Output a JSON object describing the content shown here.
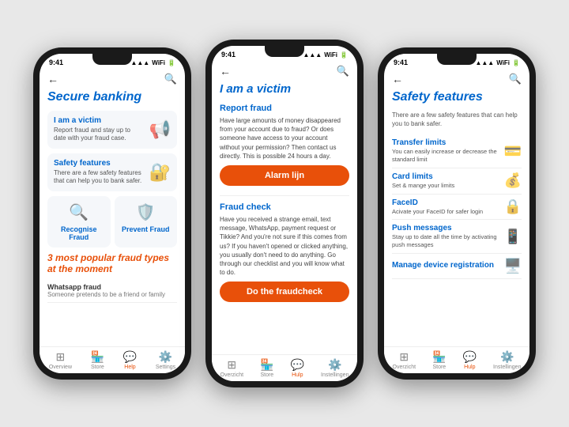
{
  "phone1": {
    "statusBar": {
      "time": "9:41",
      "signal": "▲▲▲",
      "wifi": "WiFi",
      "battery": "🔋"
    },
    "pageTitle": "Secure banking",
    "card1": {
      "title": "I am a victim",
      "desc": "Report fraud and stay up to date with your fraud case.",
      "icon": "📢"
    },
    "card2": {
      "title": "Safety features",
      "desc": "There are a few safety features that can help you to bank safer.",
      "icon": "🔐"
    },
    "smallCard1": {
      "label": "Recognise Fraud",
      "icon": "🔍"
    },
    "smallCard2": {
      "label": "Prevent Fraud",
      "icon": "🛡️"
    },
    "sectionTitle": "3 most popular fraud types at the moment",
    "listItem1": {
      "title": "Whatsapp fraud",
      "sub": "Someone pretends to be a friend or family"
    },
    "bottomNav": [
      {
        "label": "Overview",
        "icon": "⊞",
        "active": false
      },
      {
        "label": "Store",
        "icon": "🏪",
        "active": false
      },
      {
        "label": "Help",
        "icon": "💬",
        "active": true
      },
      {
        "label": "Settings",
        "icon": "⚙️",
        "active": false
      }
    ]
  },
  "phone2": {
    "statusBar": {
      "time": "9:41"
    },
    "pageTitle": "I am a victim",
    "section1Title": "Report fraud",
    "section1Desc": "Have large amounts of money disappeared from your account due to fraud? Or does someone have access to your account without your permission? Then contact us directly. This is possible 24 hours a day.",
    "btnLabel": "Alarm lijn",
    "section2Title": "Fraud check",
    "section2Desc": "Have you received a strange email, text message, WhatsApp, payment request or Tikkie? And you're not sure if this comes from us? If you haven't opened or clicked anything, you usually don't need to do anything. Go through our checklist and you will know what to do.",
    "btn2Label": "Do the fraudcheck",
    "bottomNav": [
      {
        "label": "Overzicht",
        "icon": "⊞",
        "active": false
      },
      {
        "label": "Store",
        "icon": "🏪",
        "active": false
      },
      {
        "label": "Hulp",
        "icon": "💬",
        "active": true
      },
      {
        "label": "Instellingen",
        "icon": "⚙️",
        "active": false
      }
    ]
  },
  "phone3": {
    "statusBar": {
      "time": "9:41"
    },
    "pageTitle": "Safety features",
    "intro": "There are a few safety features that can help you to bank safer.",
    "items": [
      {
        "title": "Transfer limits",
        "desc": "You can easily increase or decrease the standard limit",
        "icon": "💳"
      },
      {
        "title": "Card limits",
        "desc": "Set & mange your limits",
        "icon": "💰"
      },
      {
        "title": "FaceID",
        "desc": "Acivate your FaceID for safer login",
        "icon": "🔒"
      },
      {
        "title": "Push messages",
        "desc": "Stay up to date all the time by activating push messages",
        "icon": "📱"
      },
      {
        "title": "Manage device registration",
        "desc": "",
        "icon": "🖥️"
      }
    ],
    "bottomNav": [
      {
        "label": "Overzicht",
        "icon": "⊞",
        "active": false
      },
      {
        "label": "Store",
        "icon": "🏪",
        "active": false
      },
      {
        "label": "Hulp",
        "icon": "💬",
        "active": true
      },
      {
        "label": "Instellingen",
        "icon": "⚙️",
        "active": false
      }
    ]
  }
}
